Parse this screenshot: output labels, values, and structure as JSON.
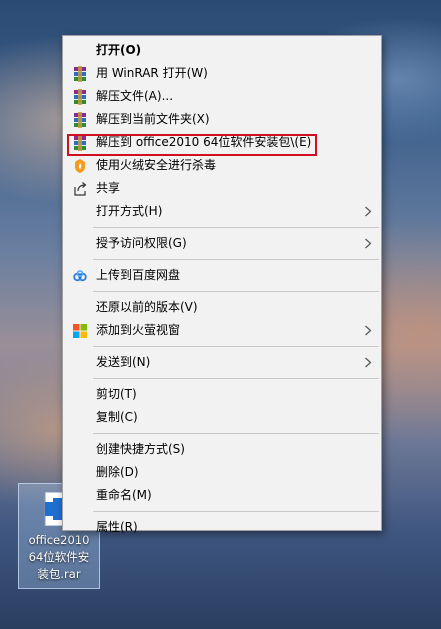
{
  "menu": {
    "items": [
      {
        "label": "打开(O)",
        "bold": true
      },
      {
        "label": "用 WinRAR 打开(W)",
        "icon": "winrar-icon"
      },
      {
        "label": "解压文件(A)...",
        "icon": "winrar-icon"
      },
      {
        "label": "解压到当前文件夹(X)",
        "icon": "winrar-icon"
      },
      {
        "label": "解压到 office2010 64位软件安装包\\(E)",
        "icon": "winrar-icon"
      },
      {
        "label": "使用火绒安全进行杀毒",
        "icon": "huorong-icon"
      },
      {
        "label": "共享",
        "icon": "share-icon"
      },
      {
        "label": "打开方式(H)",
        "submenu": true
      },
      {
        "label": "授予访问权限(G)",
        "submenu": true
      },
      {
        "label": "上传到百度网盘",
        "icon": "baidu-netdisk-icon"
      },
      {
        "label": "还原以前的版本(V)"
      },
      {
        "label": "添加到火萤视窗",
        "icon": "windows-tiles-icon",
        "submenu": true
      },
      {
        "label": "发送到(N)",
        "submenu": true
      },
      {
        "label": "剪切(T)"
      },
      {
        "label": "复制(C)"
      },
      {
        "label": "创建快捷方式(S)"
      },
      {
        "label": "删除(D)"
      },
      {
        "label": "重命名(M)"
      },
      {
        "label": "属性(R)"
      }
    ]
  },
  "desktop": {
    "file_name": "office2010\n64位软件安\n装包.rar"
  },
  "colors": {
    "menu_bg": "#f2f2f2",
    "highlight_border": "#d0101f"
  }
}
